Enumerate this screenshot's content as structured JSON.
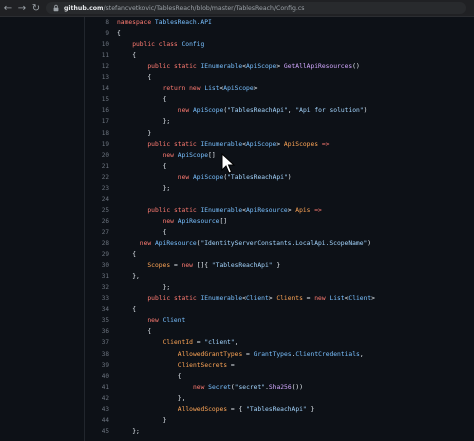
{
  "browser": {
    "url_host": "github.com",
    "url_path": "/stefancvetkovic/TablesReach/blob/master/TablesReach/Config.cs",
    "icons": {
      "back": "back-arrow-icon",
      "forward": "forward-arrow-icon",
      "reload": "reload-icon",
      "lock": "lock-icon"
    }
  },
  "colors": {
    "keyword": "#ff7b72",
    "type": "#79c0ff",
    "string": "#a5d6ff",
    "plain": "#e6edf3",
    "property": "#ffa657",
    "method": "#d2a8ff",
    "comment": "#8b949e"
  },
  "code": {
    "lines": [
      {
        "n": "8",
        "indent": 0,
        "tokens": [
          [
            "namespace ",
            "keyword"
          ],
          [
            "TablesReach.API",
            "type"
          ]
        ]
      },
      {
        "n": "9",
        "indent": 0,
        "tokens": [
          [
            "{",
            "plain"
          ]
        ]
      },
      {
        "n": "10",
        "indent": 4,
        "tokens": [
          [
            "public ",
            "keyword"
          ],
          [
            "class ",
            "keyword"
          ],
          [
            "Config",
            "type"
          ]
        ]
      },
      {
        "n": "11",
        "indent": 4,
        "tokens": [
          [
            "{",
            "plain"
          ]
        ]
      },
      {
        "n": "12",
        "indent": 8,
        "tokens": [
          [
            "public ",
            "keyword"
          ],
          [
            "static ",
            "keyword"
          ],
          [
            "IEnumerable",
            "type"
          ],
          [
            "<",
            "plain"
          ],
          [
            "ApiScope",
            "type"
          ],
          [
            "> ",
            "plain"
          ],
          [
            "GetAllApiResources",
            "method"
          ],
          [
            "()",
            "plain"
          ]
        ]
      },
      {
        "n": "13",
        "indent": 8,
        "tokens": [
          [
            "{",
            "plain"
          ]
        ]
      },
      {
        "n": "14",
        "indent": 12,
        "tokens": [
          [
            "return ",
            "keyword"
          ],
          [
            "new ",
            "keyword"
          ],
          [
            "List",
            "type"
          ],
          [
            "<",
            "plain"
          ],
          [
            "ApiScope",
            "type"
          ],
          [
            ">",
            "plain"
          ]
        ]
      },
      {
        "n": "15",
        "indent": 12,
        "tokens": [
          [
            "{",
            "plain"
          ]
        ]
      },
      {
        "n": "16",
        "indent": 16,
        "tokens": [
          [
            "new ",
            "keyword"
          ],
          [
            "ApiScope",
            "type"
          ],
          [
            "(",
            "plain"
          ],
          [
            "\"TablesReachApi\"",
            "string"
          ],
          [
            ", ",
            "plain"
          ],
          [
            "\"Api for solution\"",
            "string"
          ],
          [
            ")",
            "plain"
          ]
        ]
      },
      {
        "n": "17",
        "indent": 12,
        "tokens": [
          [
            "};",
            "plain"
          ]
        ]
      },
      {
        "n": "18",
        "indent": 8,
        "tokens": [
          [
            "}",
            "plain"
          ]
        ]
      },
      {
        "n": "19",
        "indent": 8,
        "tokens": [
          [
            "public ",
            "keyword"
          ],
          [
            "static ",
            "keyword"
          ],
          [
            "IEnumerable",
            "type"
          ],
          [
            "<",
            "plain"
          ],
          [
            "ApiScope",
            "type"
          ],
          [
            "> ",
            "plain"
          ],
          [
            "ApiScopes ",
            "property"
          ],
          [
            "=>",
            "keyword"
          ]
        ]
      },
      {
        "n": "20",
        "indent": 12,
        "tokens": [
          [
            "new ",
            "keyword"
          ],
          [
            "ApiScope",
            "type"
          ],
          [
            "[]",
            "plain"
          ]
        ]
      },
      {
        "n": "21",
        "indent": 12,
        "tokens": [
          [
            "{",
            "plain"
          ]
        ]
      },
      {
        "n": "22",
        "indent": 16,
        "tokens": [
          [
            "new ",
            "keyword"
          ],
          [
            "ApiScope",
            "type"
          ],
          [
            "(",
            "plain"
          ],
          [
            "\"TablesReachApi\"",
            "string"
          ],
          [
            ")",
            "plain"
          ]
        ]
      },
      {
        "n": "23",
        "indent": 12,
        "tokens": [
          [
            "};",
            "plain"
          ]
        ]
      },
      {
        "n": "24",
        "indent": 0,
        "tokens": []
      },
      {
        "n": "25",
        "indent": 8,
        "tokens": [
          [
            "public ",
            "keyword"
          ],
          [
            "static ",
            "keyword"
          ],
          [
            "IEnumerable",
            "type"
          ],
          [
            "<",
            "plain"
          ],
          [
            "ApiResource",
            "type"
          ],
          [
            "> ",
            "plain"
          ],
          [
            "Apis ",
            "property"
          ],
          [
            "=>",
            "keyword"
          ]
        ]
      },
      {
        "n": "26",
        "indent": 12,
        "tokens": [
          [
            "new ",
            "keyword"
          ],
          [
            "ApiResource",
            "type"
          ],
          [
            "[]",
            "plain"
          ]
        ]
      },
      {
        "n": "27",
        "indent": 12,
        "tokens": [
          [
            "{",
            "plain"
          ]
        ]
      },
      {
        "n": "28",
        "indent": 6,
        "tokens": [
          [
            "new ",
            "keyword"
          ],
          [
            "ApiResource",
            "type"
          ],
          [
            "(",
            "plain"
          ],
          [
            "\"IdentityServerConstants.LocalApi.ScopeName\"",
            "string"
          ],
          [
            ")",
            "plain"
          ]
        ]
      },
      {
        "n": "29",
        "indent": 4,
        "tokens": [
          [
            "{",
            "plain"
          ]
        ]
      },
      {
        "n": "30",
        "indent": 8,
        "tokens": [
          [
            "Scopes ",
            "property"
          ],
          [
            "= ",
            "plain"
          ],
          [
            "new ",
            "keyword"
          ],
          [
            "[]{ ",
            "plain"
          ],
          [
            "\"TablesReachApi\"",
            "string"
          ],
          [
            " }",
            "plain"
          ]
        ]
      },
      {
        "n": "31",
        "indent": 4,
        "tokens": [
          [
            "},",
            "plain"
          ]
        ]
      },
      {
        "n": "32",
        "indent": 12,
        "tokens": [
          [
            "};",
            "plain"
          ]
        ]
      },
      {
        "n": "33",
        "indent": 8,
        "tokens": [
          [
            "public ",
            "keyword"
          ],
          [
            "static ",
            "keyword"
          ],
          [
            "IEnumerable",
            "type"
          ],
          [
            "<",
            "plain"
          ],
          [
            "Client",
            "type"
          ],
          [
            "> ",
            "plain"
          ],
          [
            "Clients ",
            "property"
          ],
          [
            "= ",
            "plain"
          ],
          [
            "new ",
            "keyword"
          ],
          [
            "List",
            "type"
          ],
          [
            "<",
            "plain"
          ],
          [
            "Client",
            "type"
          ],
          [
            ">",
            "plain"
          ]
        ]
      },
      {
        "n": "34",
        "indent": 4,
        "tokens": [
          [
            "{",
            "plain"
          ]
        ]
      },
      {
        "n": "35",
        "indent": 8,
        "tokens": [
          [
            "new ",
            "keyword"
          ],
          [
            "Client",
            "type"
          ]
        ]
      },
      {
        "n": "36",
        "indent": 8,
        "tokens": [
          [
            "{",
            "plain"
          ]
        ]
      },
      {
        "n": "37",
        "indent": 12,
        "tokens": [
          [
            "ClientId ",
            "property"
          ],
          [
            "= ",
            "plain"
          ],
          [
            "\"client\"",
            "string"
          ],
          [
            ",",
            "plain"
          ]
        ]
      },
      {
        "n": "38",
        "indent": 16,
        "tokens": [
          [
            "AllowedGrantTypes ",
            "property"
          ],
          [
            "= ",
            "plain"
          ],
          [
            "GrantTypes",
            "type"
          ],
          [
            ".",
            "plain"
          ],
          [
            "ClientCredentials",
            "type"
          ],
          [
            ",",
            "plain"
          ]
        ]
      },
      {
        "n": "39",
        "indent": 16,
        "tokens": [
          [
            "ClientSecrets ",
            "property"
          ],
          [
            "=",
            "plain"
          ]
        ]
      },
      {
        "n": "40",
        "indent": 16,
        "tokens": [
          [
            "{",
            "plain"
          ]
        ]
      },
      {
        "n": "41",
        "indent": 20,
        "tokens": [
          [
            "new ",
            "keyword"
          ],
          [
            "Secret",
            "type"
          ],
          [
            "(",
            "plain"
          ],
          [
            "\"secret\"",
            "string"
          ],
          [
            ".",
            "plain"
          ],
          [
            "Sha256",
            "method"
          ],
          [
            "())",
            "plain"
          ]
        ]
      },
      {
        "n": "42",
        "indent": 16,
        "tokens": [
          [
            "},",
            "plain"
          ]
        ]
      },
      {
        "n": "43",
        "indent": 16,
        "tokens": [
          [
            "AllowedScopes ",
            "property"
          ],
          [
            "= { ",
            "plain"
          ],
          [
            "\"TablesReachApi\"",
            "string"
          ],
          [
            " }",
            "plain"
          ]
        ]
      },
      {
        "n": "44",
        "indent": 12,
        "tokens": [
          [
            "}",
            "plain"
          ]
        ]
      },
      {
        "n": "45",
        "indent": 4,
        "tokens": [
          [
            "};",
            "plain"
          ]
        ]
      }
    ]
  }
}
